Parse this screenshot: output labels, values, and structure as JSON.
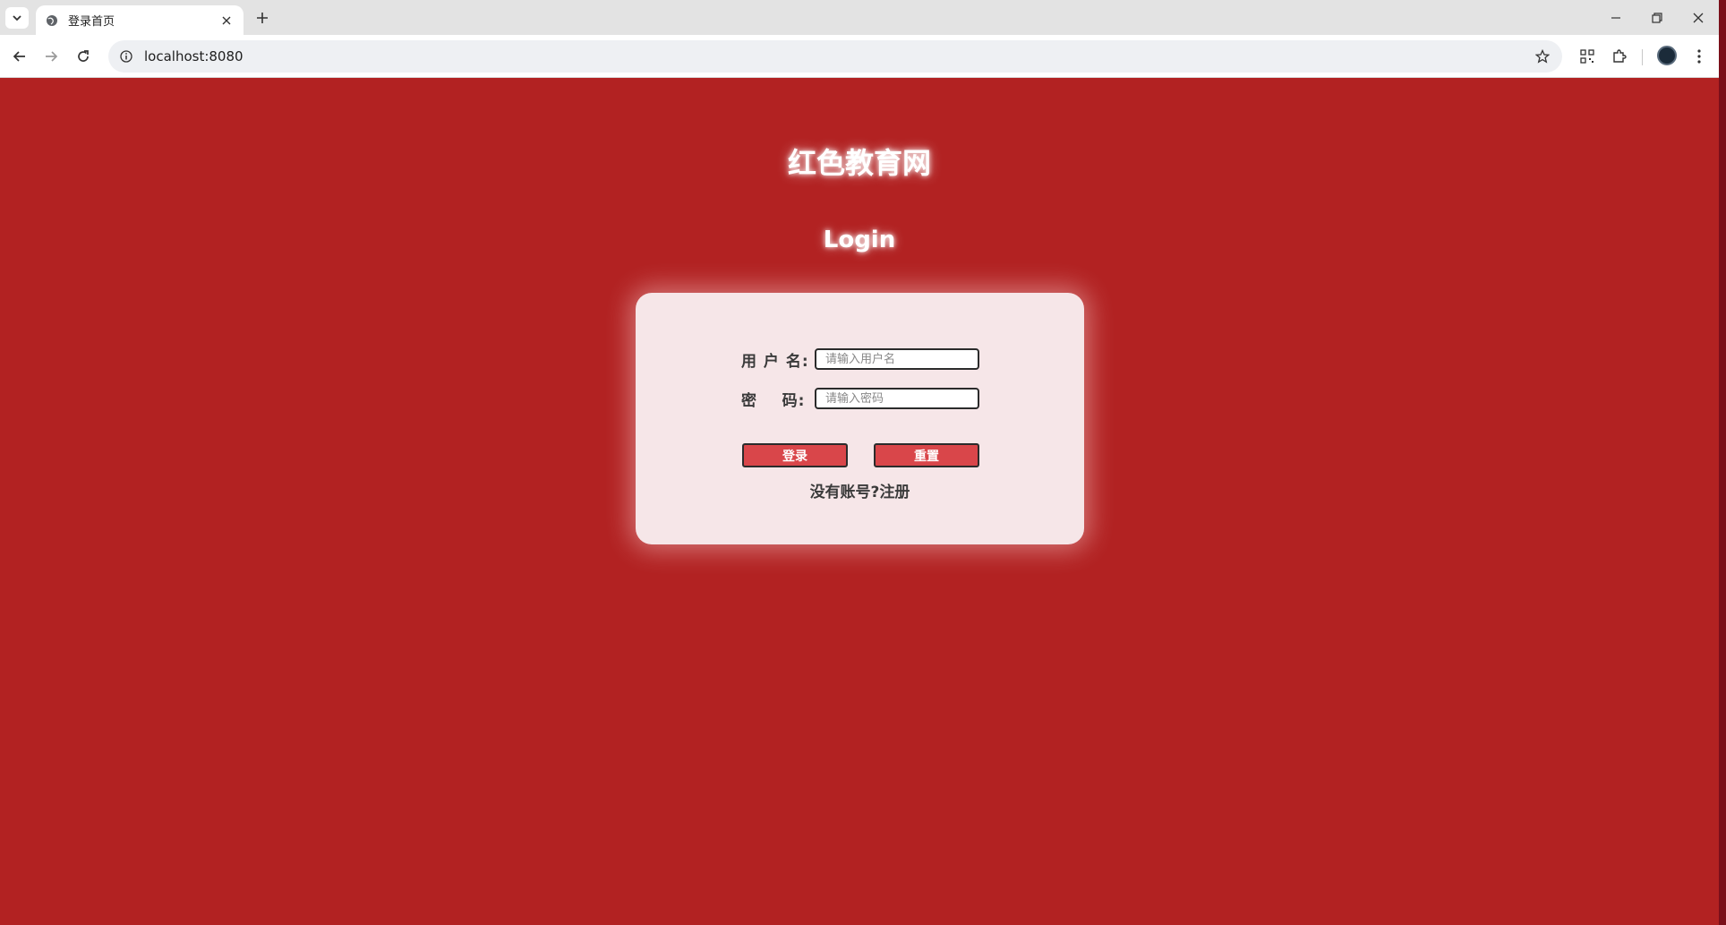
{
  "browser": {
    "tab_title": "登录首页",
    "url": "localhost:8080",
    "icons": {
      "tab_list": "chevron-down-icon",
      "favicon": "globe-icon",
      "tab_close": "close-icon",
      "new_tab": "plus-icon",
      "minimize": "minimize-icon",
      "restore": "restore-icon",
      "close_window": "close-icon",
      "back": "arrow-left-icon",
      "forward": "arrow-right-icon",
      "reload": "reload-icon",
      "site_info": "info-icon",
      "bookmark": "star-icon",
      "qr": "qr-code-icon",
      "extensions": "puzzle-icon",
      "menu": "kebab-menu-icon"
    }
  },
  "page": {
    "site_title": "红色教育网",
    "login_heading": "Login",
    "form": {
      "username_label": "用 户 名:",
      "username_placeholder": "请输入用户名",
      "password_label": "密    码:",
      "password_placeholder": "请输入密码",
      "login_button": "登录",
      "reset_button": "重置",
      "no_account_text": "没有账号?",
      "register_link": "注册"
    }
  },
  "colors": {
    "page_background": "#b22222",
    "card_background": "#f6e6e8",
    "button_background": "#d9464a",
    "text_dark": "#3a3a3a"
  }
}
